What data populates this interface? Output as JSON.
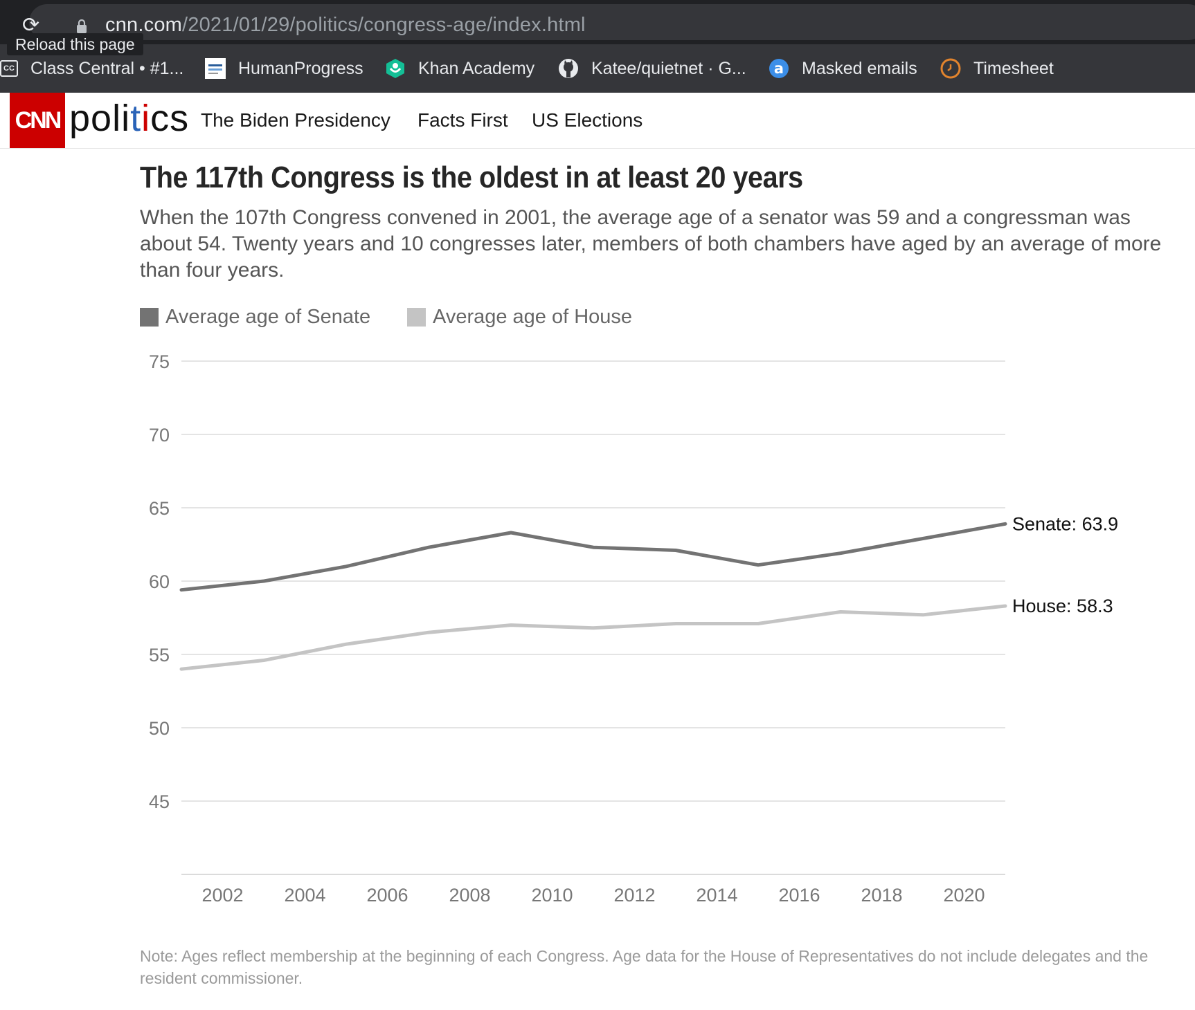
{
  "browser": {
    "url_host": "cnn.com",
    "url_path": "/2021/01/29/politics/congress-age/index.html",
    "tooltip": "Reload this page",
    "bookmarks": [
      {
        "label": "Class Central • #1...",
        "icon": "class-central-icon"
      },
      {
        "label": "HumanProgress",
        "icon": "humanprogress-icon"
      },
      {
        "label": "Khan Academy",
        "icon": "khan-academy-icon"
      },
      {
        "label": "Katee/quietnet · G...",
        "icon": "github-icon"
      },
      {
        "label": "Masked emails",
        "icon": "masked-email-icon"
      },
      {
        "label": "Timesheet",
        "icon": "timesheet-icon"
      }
    ]
  },
  "site": {
    "logo": "CNN",
    "section": "politics",
    "nav": [
      "The Biden Presidency",
      "Facts First",
      "US Elections"
    ],
    "brand_color": "#cc0000"
  },
  "article": {
    "headline": "The 117th Congress is the oldest in at least 20 years",
    "dek": "When the 107th Congress convened in 2001, the average age of a senator was 59 and a congressman was about 54. Twenty years and 10 congresses later, members of both chambers have aged by an average of more than four years.",
    "note": "Note: Ages reflect membership at the beginning of each Congress. Age data for the House of Representatives do not include delegates and the resident commissioner."
  },
  "chart_data": {
    "type": "line",
    "title": "The 117th Congress is the oldest in at least 20 years",
    "legend": [
      "Average age of Senate",
      "Average age of House"
    ],
    "legend_position": "top-left",
    "grid": true,
    "xlim": [
      2001,
      2021
    ],
    "ylim": [
      40,
      75
    ],
    "x_ticks": [
      2002,
      2004,
      2006,
      2008,
      2010,
      2012,
      2014,
      2016,
      2018,
      2020
    ],
    "y_ticks": [
      45,
      50,
      55,
      60,
      65,
      70,
      75
    ],
    "x": [
      2001,
      2003,
      2005,
      2007,
      2009,
      2011,
      2013,
      2015,
      2017,
      2019,
      2021
    ],
    "series": [
      {
        "name": "Average age of Senate",
        "color": "#737373",
        "end_label": "Senate: 63.9",
        "values": [
          59.4,
          60.0,
          61.0,
          62.3,
          63.3,
          62.3,
          62.1,
          61.1,
          61.9,
          62.9,
          63.9
        ]
      },
      {
        "name": "Average age of House",
        "color": "#c4c4c4",
        "end_label": "House: 58.3",
        "values": [
          54.0,
          54.6,
          55.7,
          56.5,
          57.0,
          56.8,
          57.1,
          57.1,
          57.9,
          57.7,
          58.3
        ]
      }
    ]
  }
}
